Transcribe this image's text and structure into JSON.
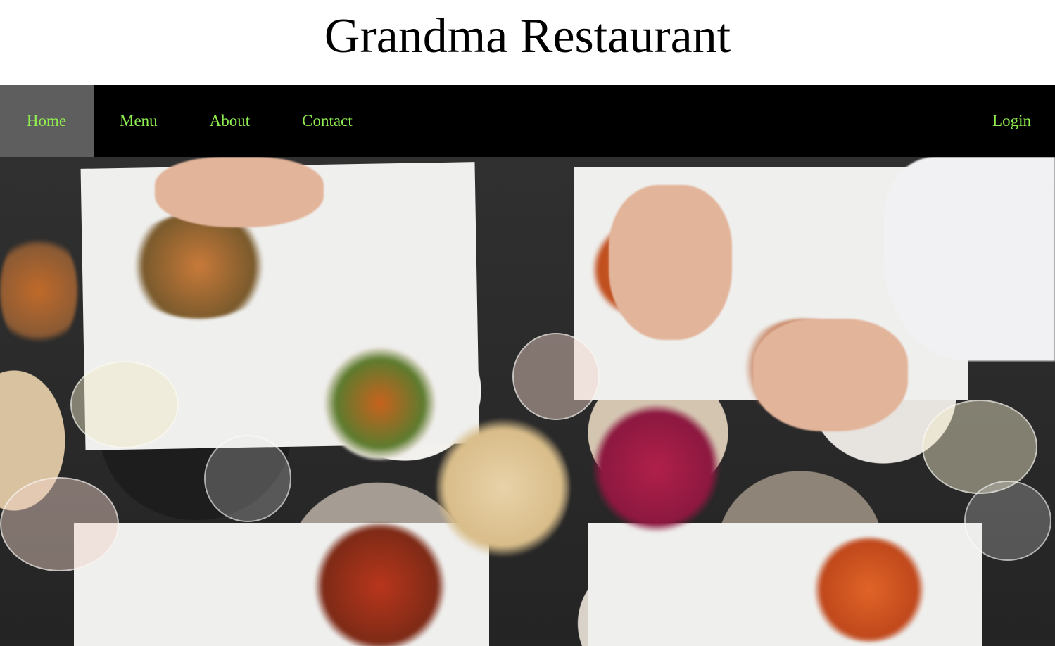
{
  "header": {
    "title": "Grandma Restaurant"
  },
  "nav": {
    "items": [
      {
        "label": "Home",
        "active": true
      },
      {
        "label": "Menu",
        "active": false
      },
      {
        "label": "About",
        "active": false
      },
      {
        "label": "Contact",
        "active": false
      }
    ],
    "login_label": "Login"
  },
  "colors": {
    "nav_background": "#000000",
    "nav_active_background": "#5e5e5e",
    "nav_text": "#90ee50"
  },
  "hero": {
    "image_alt": "Overhead view of a restaurant table with shared dishes"
  }
}
